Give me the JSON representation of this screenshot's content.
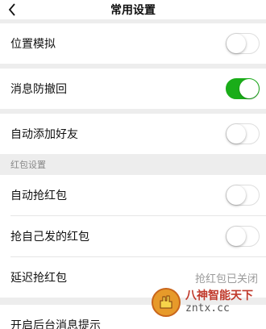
{
  "header": {
    "title": "常用设置",
    "back_icon": "chevron-left-icon"
  },
  "rows": {
    "location_mock": {
      "label": "位置模拟",
      "on": false
    },
    "anti_recall": {
      "label": "消息防撤回",
      "on": true
    },
    "auto_add_friend": {
      "label": "自动添加好友",
      "on": false
    },
    "auto_grab": {
      "label": "自动抢红包",
      "on": false
    },
    "grab_own": {
      "label": "抢自己发的红包",
      "on": false
    },
    "delay_grab": {
      "label": "延迟抢红包",
      "value": "抢红包已关闭"
    },
    "background_notice": {
      "label": "开启后台消息提示"
    }
  },
  "sections": {
    "red_packet": "红包设置"
  },
  "watermark": {
    "brand_cn": "八神智能天下",
    "domain": "zntx.cc"
  },
  "colors": {
    "toggle_on": "#1aad19",
    "background": "#ededed"
  }
}
